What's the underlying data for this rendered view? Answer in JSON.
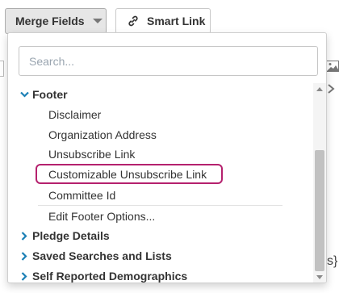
{
  "toolbar": {
    "merge_fields_label": "Merge Fields",
    "smart_link_label": "Smart Link"
  },
  "search": {
    "placeholder": "Search..."
  },
  "footer": {
    "label": "Footer",
    "items": [
      "Disclaimer",
      "Organization Address",
      "Unsubscribe Link",
      "Customizable Unsubscribe Link",
      "Committee Id"
    ],
    "edit_options": "Edit Footer Options..."
  },
  "categories": [
    "Pledge Details",
    "Saved Searches and Lists",
    "Self Reported Demographics"
  ],
  "highlighted_item": "Customizable Unsubscribe Link",
  "background": {
    "brace_text": "s}"
  },
  "colors": {
    "accent_chevron": "#1a7fb5",
    "highlight_border": "#b5216e"
  }
}
